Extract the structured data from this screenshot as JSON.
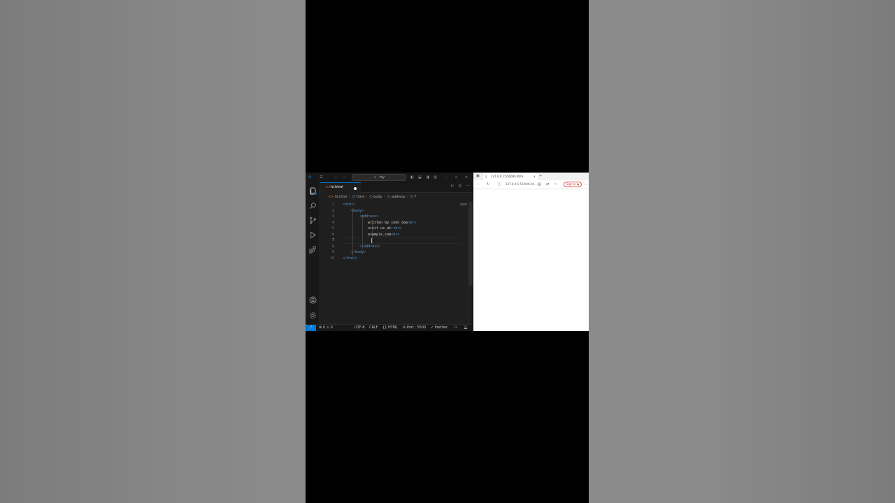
{
  "vscode": {
    "search_text": "try",
    "tab": {
      "filename": "hi.html",
      "icon": "html-file-icon"
    },
    "breadcrumb": [
      "hi.html",
      "html",
      "body",
      "address",
      "?"
    ],
    "code_lines": [
      {
        "n": "1",
        "indent": 0,
        "open": "<",
        "tag": "html",
        "close": ">",
        "text": ""
      },
      {
        "n": "2",
        "indent": 1,
        "open": "<",
        "tag": "body",
        "close": ">",
        "text": ""
      },
      {
        "n": "3",
        "indent": 2,
        "open": "<",
        "tag": "address",
        "close": ">",
        "text": ""
      },
      {
        "n": "4",
        "indent": 3,
        "text": "written by john doe",
        "tail": "<br>"
      },
      {
        "n": "5",
        "indent": 3,
        "text": "visit us at:",
        "tail": "<br>"
      },
      {
        "n": "6",
        "indent": 3,
        "text": "example.com",
        "tail": "<br>"
      },
      {
        "n": "7",
        "indent": 3,
        "text": ""
      },
      {
        "n": "8",
        "indent": 2,
        "open": "</",
        "tag": "address",
        "close": ">",
        "text": ""
      },
      {
        "n": "9",
        "indent": 1,
        "open": "</",
        "tag": "body",
        "close": ">",
        "text": ""
      },
      {
        "n": "10",
        "indent": 0,
        "open": "</",
        "tag": "html",
        "close": ">",
        "text": ""
      }
    ],
    "active_line": "7",
    "status": {
      "errors": "0",
      "warnings": "0",
      "encoding": "UTF-8",
      "eol": "CRLF",
      "language": "HTML",
      "port": "Port : 5500",
      "formatter": "Prettier"
    }
  },
  "browser": {
    "tab_title": "127.0.0.1:5500/hi.html",
    "url": "127.0.0.1:5500/hi.ht...",
    "signin_label": "Sign in"
  },
  "colors": {
    "accent": "#0078d4",
    "editor_bg": "#1f1f1f",
    "tag": "#569cd6"
  }
}
